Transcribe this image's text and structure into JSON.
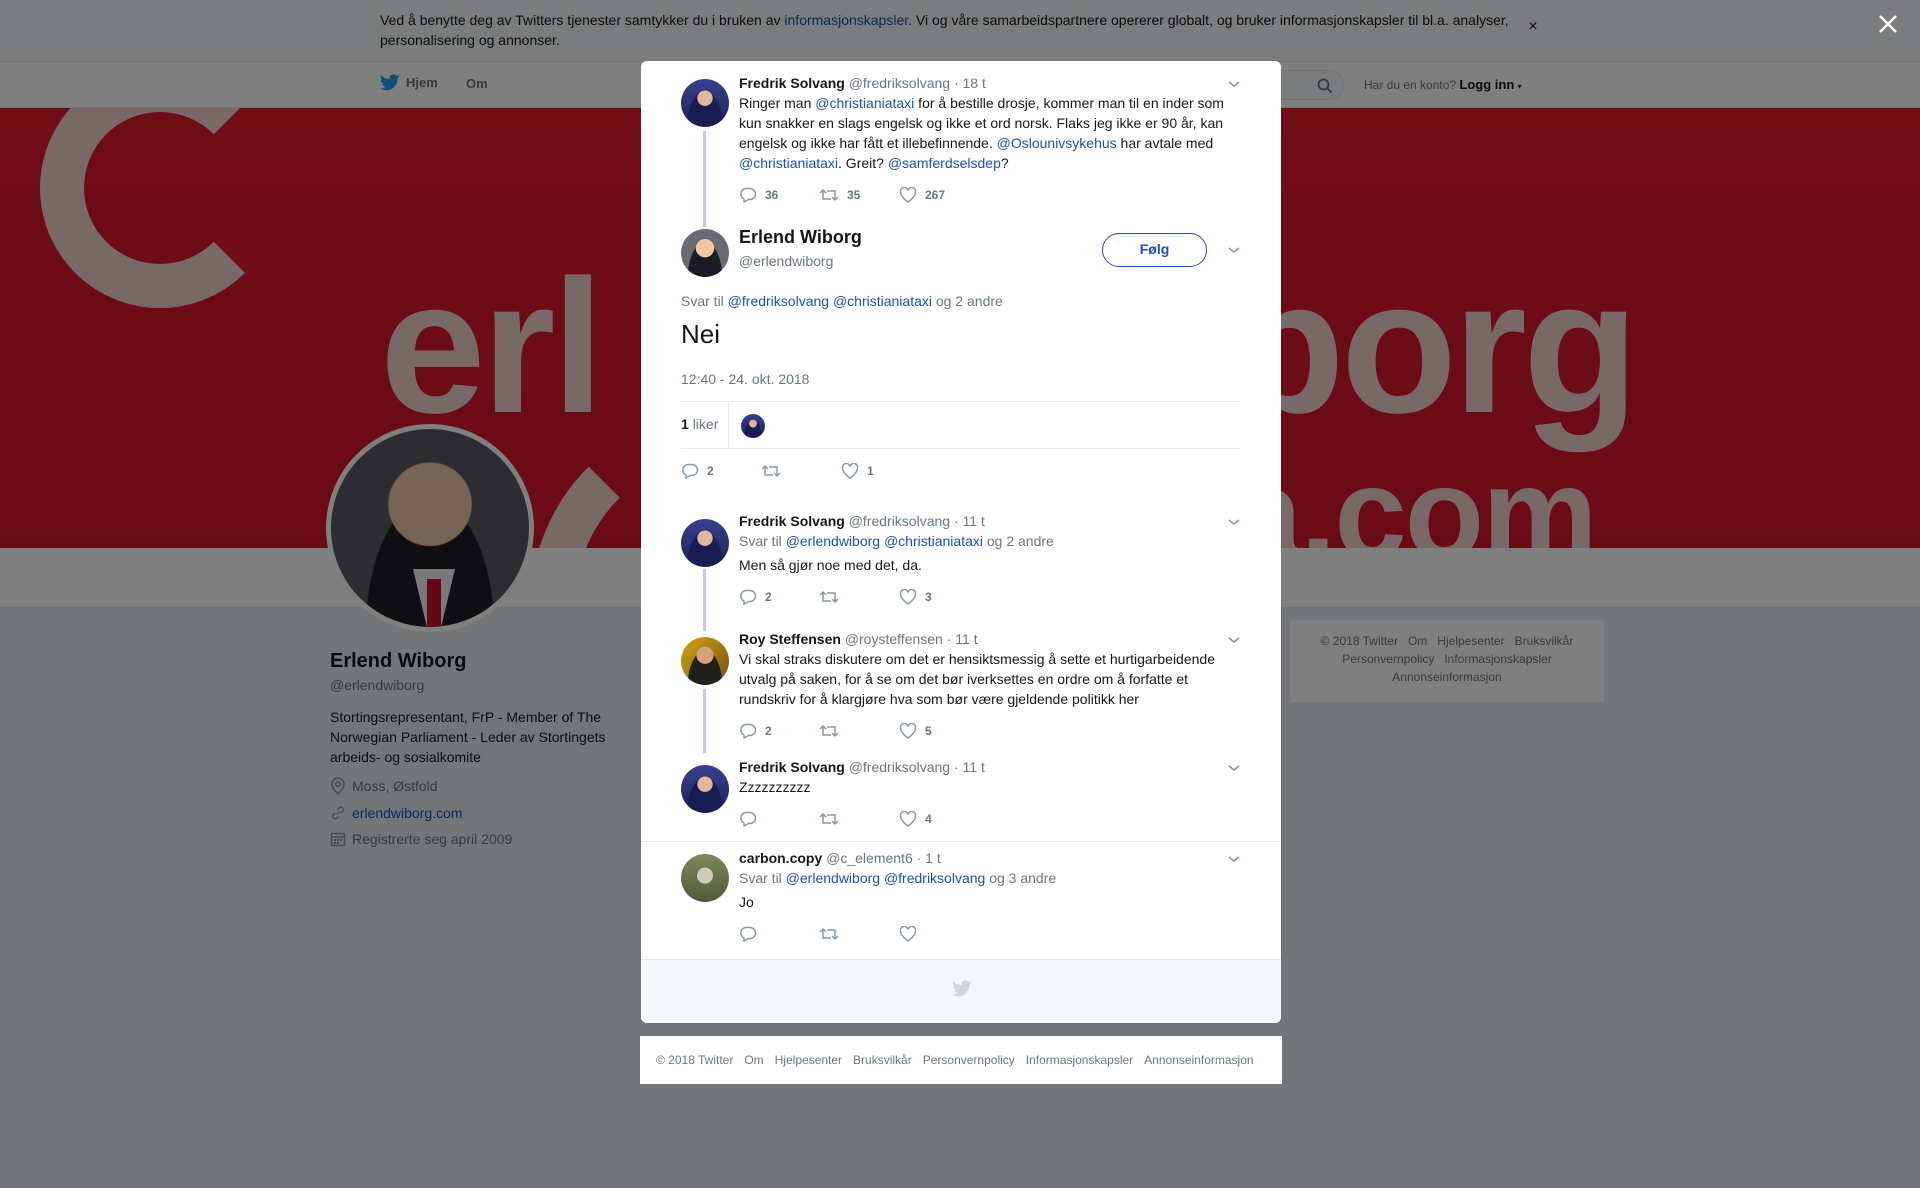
{
  "cookie_bar": {
    "text_before": "Ved å benytte deg av Twitters tjenester samtykker du i bruken av ",
    "link": "informasjonskapsler",
    "text_after": ". Vi og våre samarbeidspartnere opererer globalt, og bruker informasjonskapsler til bl.a. analyser, personalisering og annonser.",
    "close": "×"
  },
  "nav": {
    "home": "Hjem",
    "about": "Om",
    "account_prompt": "Har du en konto?",
    "login": "Logg inn"
  },
  "profile": {
    "name": "Erlend Wiborg",
    "handle": "@erlendwiborg",
    "bio": "Stortingsrepresentant, FrP - Member of The Norwegian Parliament - Leder av Stortingets arbeids- og sosialkomite",
    "location": "Moss, Østfold",
    "website": "erlendwiborg.com",
    "joined": "Registrerte seg april 2009"
  },
  "side_footer": {
    "links": [
      "© 2018 Twitter",
      "Om",
      "Hjelpesenter",
      "Bruksvilkår",
      "Personvernpolicy",
      "Informasjonskapsler",
      "Annonseinformasjon"
    ]
  },
  "modal": {
    "parent_tweet": {
      "name": "Fredrik Solvang",
      "handle": "@fredriksolvang",
      "time": "· 18 t",
      "text_parts": [
        "Ringer man ",
        "@christianiataxi",
        " for å bestille drosje, kommer man til en inder som kun snakker en slags engelsk og ikke et ord norsk. Flaks jeg ikke er 90 år, kan engelsk og ikke har fått et illebefinnende. ",
        "@Oslounivsykehus",
        " har avtale med ",
        "@christianiataxi",
        ". Greit? ",
        "@samferdselsdep",
        "?"
      ],
      "replies": "36",
      "retweets": "35",
      "likes": "267"
    },
    "main_tweet": {
      "name": "Erlend Wiborg",
      "handle": "@erlendwiborg",
      "follow": "Følg",
      "reply_label": "Svar til",
      "reply_mention_1": "@fredriksolvang",
      "reply_mention_2": "@christianiataxi",
      "reply_others": "og 2 andre",
      "text": "Nei",
      "timestamp": "12:40 - 24. okt. 2018",
      "likes_count": "1",
      "likes_label": "liker",
      "replies": "2",
      "retweets": "",
      "likes": "1"
    },
    "replies": [
      {
        "name": "Fredrik Solvang",
        "handle": "@fredriksolvang",
        "time": "· 11 t",
        "reply_label": "Svar til",
        "mention_1": "@erlendwiborg",
        "mention_2": "@christianiataxi",
        "others": "og 2 andre",
        "text": "Men så gjør noe med det, da.",
        "replies": "2",
        "retweets": "",
        "likes": "3"
      },
      {
        "name": "Roy Steffensen",
        "handle": "@roysteffensen",
        "time": "· 11 t",
        "text": "Vi skal straks diskutere om det er hensiktsmessig å sette et hurtigarbeidende utvalg på saken, for å se om det bør iverksettes en ordre om å forfatte et rundskriv for å klargjøre hva som bør være gjeldende politikk her",
        "replies": "2",
        "retweets": "",
        "likes": "5"
      },
      {
        "name": "Fredrik Solvang",
        "handle": "@fredriksolvang",
        "time": "· 11 t",
        "text": "Zzzzzzzzzz",
        "replies": "",
        "retweets": "",
        "likes": "4"
      },
      {
        "name": "carbon.copy",
        "handle": "@c_element6",
        "time": "· 1 t",
        "reply_label": "Svar til",
        "mention_1": "@erlendwiborg",
        "mention_2": "@fredriksolvang",
        "others": "og 3 andre",
        "text": "Jo",
        "replies": "",
        "retweets": "",
        "likes": ""
      }
    ]
  },
  "footer": {
    "links": [
      "© 2018 Twitter",
      "Om",
      "Hjelpesenter",
      "Bruksvilkår",
      "Personvernpolicy",
      "Informasjonskapsler",
      "Annonseinformasjon"
    ]
  },
  "banner_text": [
    "erl",
    "iborg",
    "a.com"
  ],
  "colors": {
    "link": "#1b4dc2",
    "banner": "#e01a2b",
    "overlay": "rgba(0,0,0,0.5)"
  }
}
